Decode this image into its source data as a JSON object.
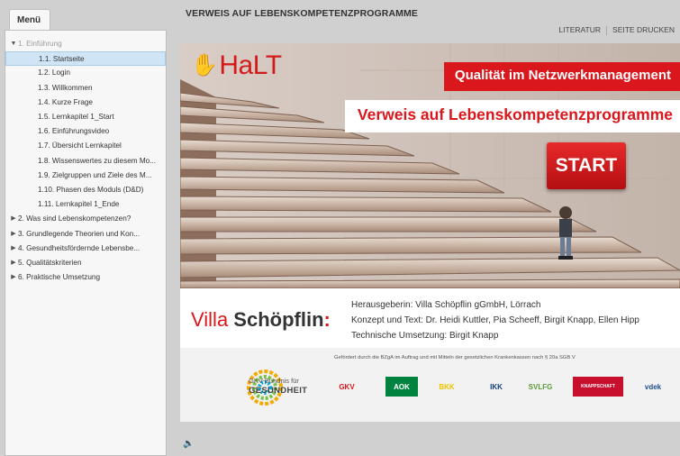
{
  "sidebar": {
    "menu_tab": "Menü",
    "items": [
      {
        "label": "1. Einführung",
        "tri": "▼",
        "level": 0,
        "dim": true
      },
      {
        "label": "1.1. Startseite",
        "tri": "",
        "level": 1,
        "active": true
      },
      {
        "label": "1.2. Login",
        "tri": "",
        "level": 1
      },
      {
        "label": "1.3. Willkommen",
        "tri": "",
        "level": 1
      },
      {
        "label": "1.4. Kurze Frage",
        "tri": "",
        "level": 1
      },
      {
        "label": "1.5. Lernkapitel 1_Start",
        "tri": "",
        "level": 1
      },
      {
        "label": "1.6. Einführungsvideo",
        "tri": "",
        "level": 1
      },
      {
        "label": "1.7. Übersicht Lernkapitel",
        "tri": "",
        "level": 1
      },
      {
        "label": "1.8. Wissenswertes zu diesem Mo...",
        "tri": "",
        "level": 1
      },
      {
        "label": "1.9. Zielgruppen und Ziele des M...",
        "tri": "",
        "level": 1
      },
      {
        "label": "1.10. Phasen des Moduls (D&D)",
        "tri": "",
        "level": 1
      },
      {
        "label": "1.11. Lernkapitel 1_Ende",
        "tri": "",
        "level": 1
      },
      {
        "label": "2. Was sind Lebenskompetenzen?",
        "tri": "▶",
        "level": 0
      },
      {
        "label": "3. Grundlegende Theorien und Kon...",
        "tri": "▶",
        "level": 0
      },
      {
        "label": "4. Gesundheitsfördernde Lebensbe...",
        "tri": "▶",
        "level": 0
      },
      {
        "label": "5. Qualitätskriterien",
        "tri": "▶",
        "level": 0
      },
      {
        "label": "6. Praktische Umsetzung",
        "tri": "▶",
        "level": 0
      }
    ]
  },
  "header": {
    "title": "VERWEIS AUF LEBENSKOMPETENZPROGRAMME",
    "link_literatur": "LITERATUR",
    "link_print": "SEITE DRUCKEN"
  },
  "slide": {
    "logo": "HaLT",
    "banner_top": "Qualität im Netzwerkmanagement",
    "banner_main": "Verweis auf Lebenskompetenzprogramme",
    "start_label": "START",
    "villa_1": "Villa ",
    "villa_2": "Schöpflin",
    "villa_3": ":",
    "credit_1": "Herausgeberin: Villa Schöpflin gGmbH, Lörrach",
    "credit_2": "Konzept und Text: Dr. Heidi Kuttler, Pia Scheeff, Birgit Knapp, Ellen Hipp",
    "credit_3": "Technische Umsetzung: Birgit Knapp",
    "sponsor_note": "Gefördert durch die BZgA im Auftrag und mit Mitteln der gesetzlichen Krankenkassen nach § 20a SGB V",
    "gkv_1": "GKV-Bündnis für",
    "gkv_2": "GESUNDHEIT",
    "kassen": [
      "GKV",
      "AOK",
      "BKK",
      "IKK",
      "SVLFG",
      "KNAPPSCHAFT",
      "vdek"
    ]
  },
  "colors": {
    "accent_red": "#d9171c",
    "sidebar_active": "#cfe4f4"
  },
  "icons": {
    "audio": "speaker-icon"
  }
}
